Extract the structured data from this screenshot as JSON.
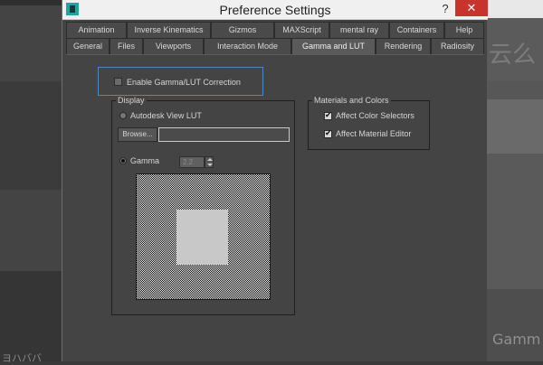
{
  "window": {
    "title": "Preference Settings",
    "help_label": "?",
    "close_label": "✕"
  },
  "tabs": {
    "row1": [
      "Animation",
      "Inverse Kinematics",
      "Gizmos",
      "MAXScript",
      "mental ray",
      "Containers",
      "Help"
    ],
    "row2": [
      "General",
      "Files",
      "Viewports",
      "Interaction Mode",
      "Gamma and LUT",
      "Rendering",
      "Radiosity"
    ],
    "active": "Gamma and LUT"
  },
  "gamma_lut": {
    "enable_label": "Enable Gamma/LUT Correction",
    "enable_checked": false,
    "display": {
      "title": "Display",
      "lut_label": "Autodesk View LUT",
      "lut_selected": false,
      "browse_label": "Browse...",
      "lut_path": "",
      "gamma_label": "Gamma",
      "gamma_selected": true,
      "gamma_value": "2.2"
    },
    "materials": {
      "title": "Materials and Colors",
      "affect_color_selectors": "Affect Color Selectors",
      "affect_color_selectors_checked": true,
      "affect_material_editor": "Affect Material Editor",
      "affect_material_editor_checked": true
    }
  },
  "background": {
    "ghost_right_top": "云么",
    "ghost_right_bottom": "Gamm",
    "ghost_left_bottom": "ヨハババ"
  }
}
